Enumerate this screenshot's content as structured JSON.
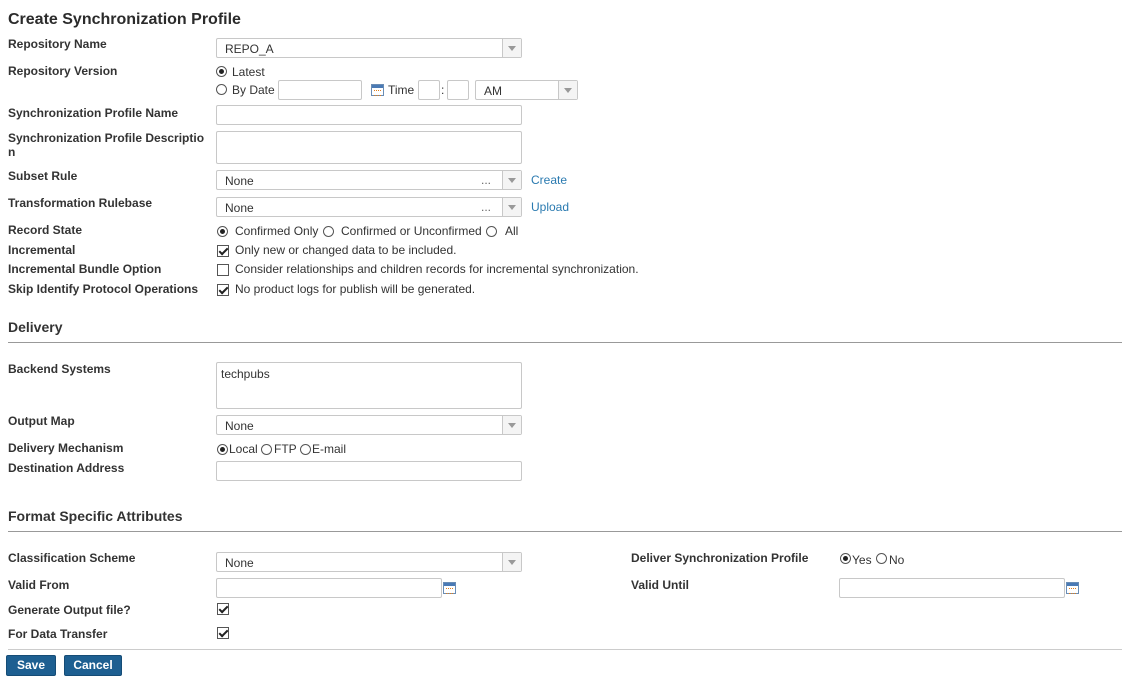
{
  "title": "Create Synchronization Profile",
  "labels": {
    "repository_name": "Repository Name",
    "repository_version": "Repository Version",
    "sync_profile_name": "Synchronization Profile Name",
    "sync_profile_desc_1": "Synchronization Profile Descriptio",
    "sync_profile_desc_2": "n",
    "subset_rule": "Subset Rule",
    "transformation_rulebase": "Transformation Rulebase",
    "record_state": "Record State",
    "incremental": "Incremental",
    "incremental_bundle": "Incremental Bundle Option",
    "skip_identify": "Skip Identify Protocol Operations",
    "backend_systems": "Backend Systems",
    "output_map": "Output Map",
    "delivery_mechanism": "Delivery Mechanism",
    "destination_address": "Destination Address",
    "classification_scheme": "Classification Scheme",
    "valid_from": "Valid From",
    "generate_output": "Generate Output file?",
    "for_data_transfer": "For Data Transfer",
    "deliver_sync_profile": "Deliver Synchronization Profile",
    "valid_until": "Valid Until"
  },
  "repository_name_value": "REPO_A",
  "version": {
    "latest": "Latest",
    "by_date": "By Date",
    "time_label": "Time",
    "time_sep": ":",
    "ampm": "AM",
    "selected": "latest"
  },
  "subset_rule": {
    "value": "None",
    "dots": "...",
    "link": "Create"
  },
  "transformation": {
    "value": "None",
    "dots": "...",
    "link": "Upload"
  },
  "record_state": {
    "options": [
      "Confirmed Only",
      "Confirmed or Unconfirmed",
      "All"
    ],
    "selected": 0
  },
  "incremental_text": "Only new or changed data to be included.",
  "incremental_checked": true,
  "incremental_bundle_text": "Consider relationships and children records for incremental synchronization.",
  "incremental_bundle_checked": false,
  "skip_identify_text": "No product logs for publish will be generated.",
  "skip_identify_checked": true,
  "sections": {
    "delivery": "Delivery",
    "format": "Format Specific Attributes"
  },
  "backend_systems_value": "techpubs",
  "output_map_value": "None",
  "delivery_mechanism": {
    "options": [
      "Local",
      "FTP",
      "E-mail"
    ],
    "selected": 0
  },
  "classification_scheme_value": "None",
  "deliver_sync_profile": {
    "options": [
      "Yes",
      "No"
    ],
    "selected": 0
  },
  "generate_output_checked": true,
  "for_data_transfer_checked": true,
  "buttons": {
    "save": "Save",
    "cancel": "Cancel"
  },
  "colors": {
    "link": "#2a7ab0",
    "button": "#1d5f91"
  }
}
